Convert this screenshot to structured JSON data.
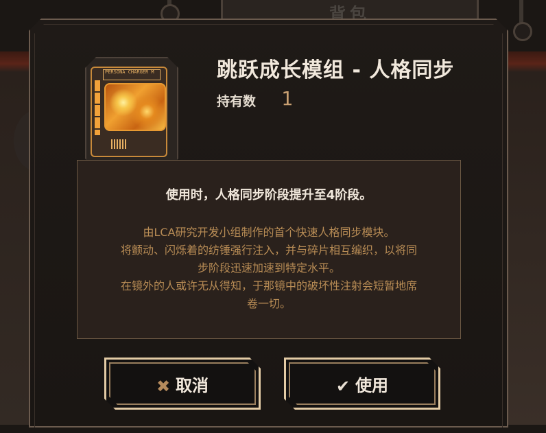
{
  "background": {
    "tab_label": "背包"
  },
  "dialog": {
    "item": {
      "title": "跳跃成长模组 - 人格同步",
      "held_label": "持有数",
      "held_count": "1",
      "icon": "sync-module-card-icon",
      "icon_label": "PERSONA CHARGER M"
    },
    "description": {
      "effect": "使用时，人格同步阶段提升至4阶段。",
      "flavor_lines": [
        "由LCA研究开发小组制作的首个快速人格同步模块。",
        "将颤动、闪烁着的纺锤强行注入，并与碎片相互编织，以将同",
        "步阶段迅速加速到特定水平。",
        "在镜外的人或许无从得知，于那镜中的破坏性注射会短暂地席",
        "卷一切。"
      ]
    },
    "buttons": {
      "cancel_label": "取消",
      "cancel_icon": "close-icon",
      "use_label": "使用",
      "use_icon": "check-icon"
    }
  },
  "colors": {
    "accent_gold": "#c9a072",
    "flavor_text": "#b88c55",
    "title_text": "#f1e8dc",
    "button_border": "#e3cba5"
  }
}
